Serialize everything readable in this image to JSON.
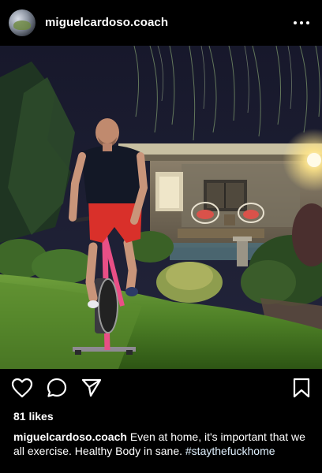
{
  "post": {
    "username": "miguelcardoso.coach",
    "likes": "81 likes",
    "caption_user": "miguelcardoso.coach",
    "caption_text": " Even at home, it's important that we all exercise. Healthy Body in sane. ",
    "hashtag": "#staythefuckhome"
  },
  "icons": {
    "more": "more-options-icon",
    "like": "heart-icon",
    "comment": "comment-icon",
    "share": "paper-plane-icon",
    "save": "bookmark-icon"
  },
  "colors": {
    "background": "#000000",
    "text": "#ffffff",
    "shorts": "#d9302a",
    "bike_frame": "#e94f86"
  }
}
